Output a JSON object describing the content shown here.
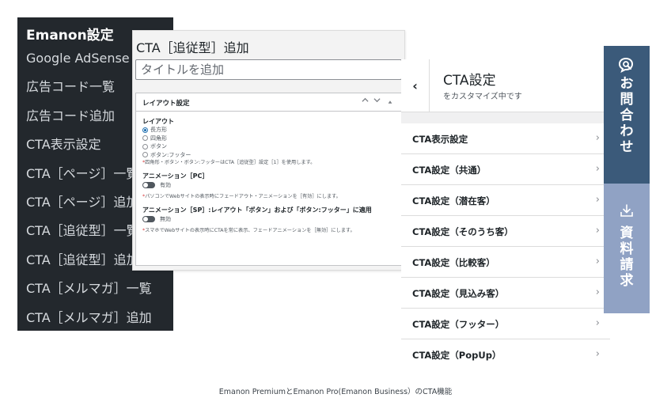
{
  "admin_menu": {
    "title": "Emanon設定",
    "items": [
      "Google AdSense",
      "広告コード一覧",
      "広告コード追加",
      "CTA表示設定",
      "CTA［ページ］一覧",
      "CTA［ページ］追加",
      "CTA［追従型］一覧",
      "CTA［追従型］追加",
      "CTA［メルマガ］一覧",
      "CTA［メルマガ］追加"
    ]
  },
  "cta_panel": {
    "title": "CTA［追従型］追加",
    "title_placeholder": "タイトルを追加",
    "box_title": "レイアウト設定",
    "controls": {
      "up": "^",
      "down": "v",
      "toggle": "▲"
    },
    "layout": {
      "label": "レイアウト",
      "options": [
        "長方形",
        "四角形",
        "ボタン",
        "ボタン:フッター"
      ],
      "selected": "長方形",
      "note": "四角形・ボタン・ボタン:フッターはCTA［追従型］設定［1］を使用します。"
    },
    "animation_pc": {
      "label": "アニメーション［PC］",
      "state": "有効",
      "note": "パソコンでWebサイトの表示時にフェードアウト・アニメーションを［有効］にします。"
    },
    "animation_sp": {
      "label": "アニメーション［SP］:レイアウト「ボタン」および「ボタン:フッター」に適用",
      "state": "無効",
      "note": "スマホでWebサイトの表示時にCTAを常に表示、フェードアニメーションを［無効］にします。"
    },
    "note_mark": "*"
  },
  "customizer": {
    "back": "‹",
    "title": "CTA設定",
    "subtitle": "をカスタマイズ中です",
    "items": [
      "CTA表示設定",
      "CTA設定（共通）",
      "CTA設定（潜在客）",
      "CTA設定（そのうち客）",
      "CTA設定（比較客）",
      "CTA設定（見込み客）",
      "CTA設定（フッター）",
      "CTA設定（PopUp）"
    ],
    "chevron": "›"
  },
  "side_buttons": {
    "contact": {
      "icon": "chat-search-icon",
      "text": "お問合わせ",
      "color": "#3b5a7a"
    },
    "docs": {
      "icon": "download-icon",
      "text": "資料請求",
      "color": "#90a2c4"
    }
  },
  "caption": "Emanon PremiumとEmanon Pro(Emanon Business）のCTA機能"
}
